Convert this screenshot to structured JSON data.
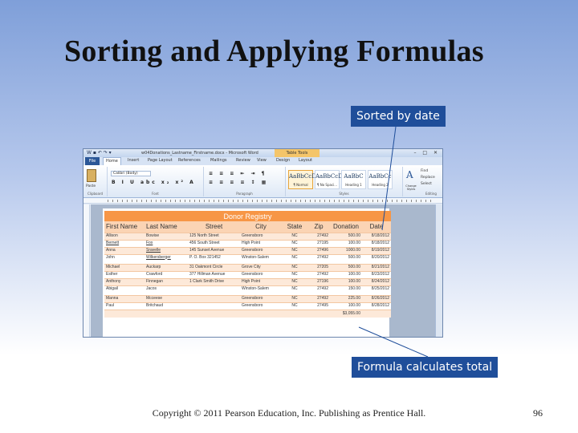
{
  "slide": {
    "title": "Sorting and Applying Formulas",
    "callout_top": "Sorted by date",
    "callout_bottom": "Formula calculates total",
    "footer": "Copyright © 2011 Pearson Education, Inc. Publishing as Prentice Hall.",
    "page_number": "96"
  },
  "colors": {
    "callout_bg": "#1f4e9a",
    "table_banner": "#f79646",
    "table_header": "#fbd4b4",
    "table_band": "#fde9d9"
  },
  "word": {
    "window_title": "w04Donations_Lastname_Firstname.docx - Microsoft Word",
    "context_tab": "Table Tools",
    "tabs": [
      "File",
      "Home",
      "Insert",
      "Page Layout",
      "References",
      "Mailings",
      "Review",
      "View",
      "Design",
      "Layout"
    ],
    "font_name": "Calibri (Body)",
    "group_labels": [
      "Clipboard",
      "Font",
      "Paragraph",
      "Styles",
      "Editing"
    ],
    "paste_label": "Paste",
    "styles": [
      {
        "sample": "AaBbCcDc",
        "name": "¶ No Spaci..."
      },
      {
        "sample": "AaBbCcDc",
        "name": "¶ Normal"
      },
      {
        "sample": "AaBbC",
        "name": "Heading 1"
      },
      {
        "sample": "AaBbCc",
        "name": "Heading 2"
      },
      {
        "sample": "A",
        "name": "Change Styles"
      }
    ],
    "editing": [
      "Find",
      "Replace",
      "Select"
    ]
  },
  "table": {
    "title": "Donor Registry",
    "headers": [
      "First Name",
      "Last Name",
      "Street",
      "City",
      "State",
      "Zip",
      "Donation",
      "Date"
    ],
    "rows": [
      [
        "Allison",
        "Bowise",
        "125 North Street",
        "Greensboro",
        "NC",
        "27492",
        "500.00",
        "8/18/2012"
      ],
      [
        "Bernett",
        "Fox",
        "456 South Street",
        "High Point",
        "NC",
        "27195",
        "100.00",
        "8/18/2012"
      ],
      [
        "Anna",
        "Sravelle",
        "145 Sunset Avenue",
        "Greensboro",
        "NC",
        "27496",
        "1000.00",
        "8/19/2012"
      ],
      [
        "John",
        "Wilkersberger",
        "P. O. Box 321452",
        "Winston-Salem",
        "NC",
        "27492",
        "500.00",
        "8/20/2012"
      ],
      [
        "Michael",
        "Auckarp",
        "31 Oakmont Circle",
        "Grove City",
        "NC",
        "27205",
        "500.00",
        "8/21/2012"
      ],
      [
        "Esther",
        "Crawford",
        "377 Hillman Avenue",
        "Greensboro",
        "NC",
        "27492",
        "100.00",
        "8/23/2012"
      ],
      [
        "Anthony",
        "Finnegan",
        "1 Clark Smith Drive",
        "High Point",
        "NC",
        "27196",
        "100.00",
        "8/24/2012"
      ],
      [
        "Abigail",
        "Jacos",
        "",
        "Winston-Salem",
        "NC",
        "27492",
        "150.00",
        "8/25/2012"
      ],
      [
        "Manna",
        "Mcceese",
        "",
        "Greensboro",
        "NC",
        "27492",
        "225.00",
        "8/26/2012"
      ],
      [
        "Paul",
        "Britchaud",
        "",
        "Greensboro",
        "NC",
        "27495",
        "100.00",
        "8/28/2012"
      ]
    ],
    "total": "$3,055.00"
  }
}
